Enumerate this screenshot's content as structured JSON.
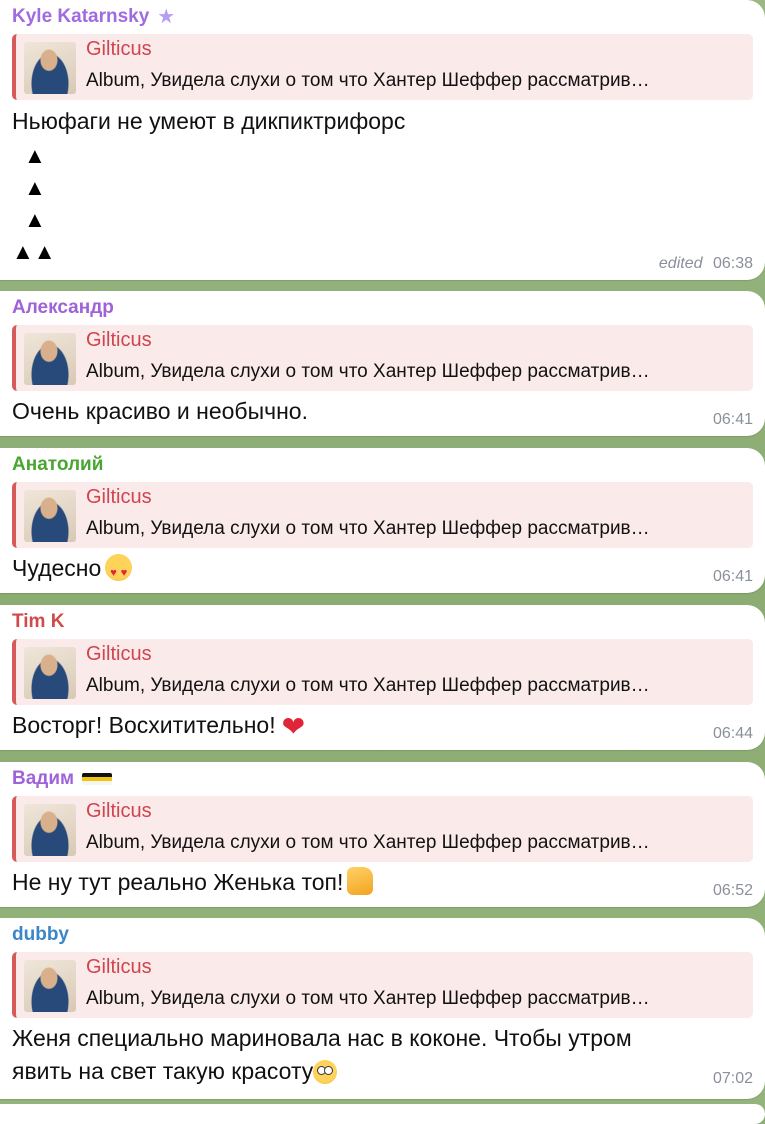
{
  "reply": {
    "author": "Gilticus",
    "text": "Album, Увидела слухи о том что Хантер Шеффер рассматрив…"
  },
  "messages": [
    {
      "sender": "Kyle Katarnsky",
      "sender_color": "#a06ae0",
      "text": "Ньюфаги не умеют в дикпиктрифорс",
      "art_lines": [
        "▲",
        "▲",
        "▲",
        "▲▲"
      ],
      "edited": "edited",
      "time": "06:38"
    },
    {
      "sender": "Александр",
      "sender_color": "#9f62d8",
      "text": "Очень красиво и необычно.",
      "time": "06:41"
    },
    {
      "sender": "Анатолий",
      "sender_color": "#4aa532",
      "text": "Чудесно",
      "time": "06:41"
    },
    {
      "sender": "Tim K",
      "sender_color": "#d04a4a",
      "text": "Восторг! Восхитительно!",
      "time": "06:44"
    },
    {
      "sender": "Вадим",
      "sender_color": "#9f62d8",
      "text": "Не ну тут реально Женька топ!",
      "time": "06:52"
    },
    {
      "sender": "dubby",
      "sender_color": "#3a86c8",
      "text_lines": [
        "Женя специально мариновала нас в коконе. Чтобы утром",
        "явить на свет такую красоту"
      ],
      "time": "07:02"
    }
  ]
}
